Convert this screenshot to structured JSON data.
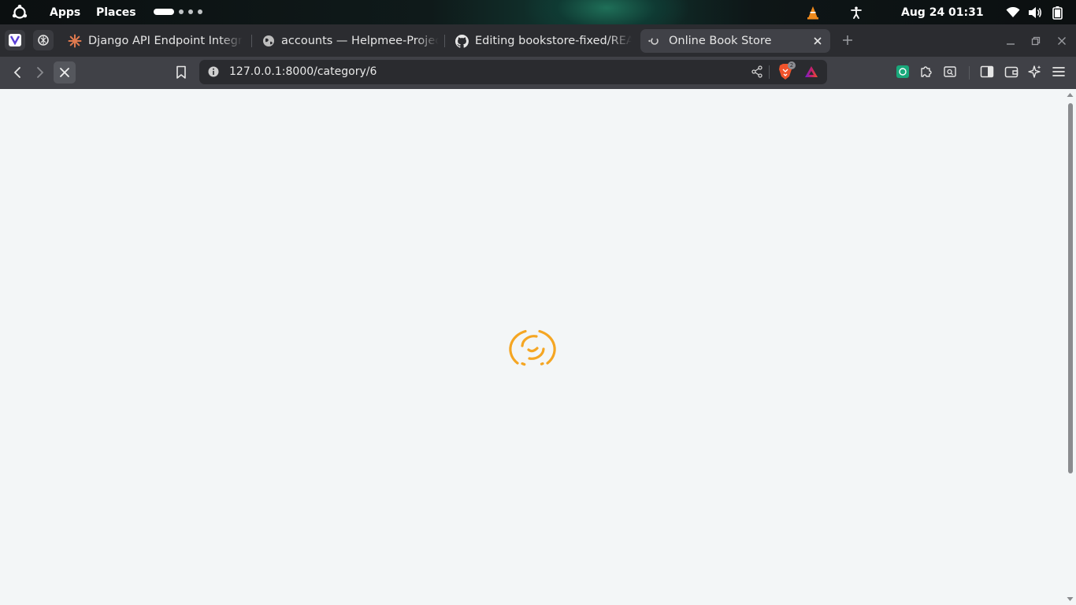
{
  "system_bar": {
    "apps_label": "Apps",
    "places_label": "Places",
    "datetime": "Aug 24  01:31"
  },
  "browser": {
    "tabs": [
      {
        "title": "Django API Endpoint Integr",
        "icon": "claude-icon",
        "active": false
      },
      {
        "title": "accounts — Helpmee-Projec",
        "icon": "globe-icon",
        "active": false
      },
      {
        "title": "Editing bookstore-fixed/REA",
        "icon": "github-icon",
        "active": false
      },
      {
        "title": "Online Book Store",
        "icon": "loading-icon",
        "active": true
      }
    ],
    "address": "127.0.0.1:8000/category/6",
    "shield_count": "2"
  },
  "page": {
    "state": "loading",
    "spinner_color": "#f5a623"
  },
  "colors": {
    "accent": "#f5a623",
    "page_bg": "#f3f6f7",
    "toolbar_bg": "#404147",
    "tabstrip_bg": "#2b2c30"
  }
}
